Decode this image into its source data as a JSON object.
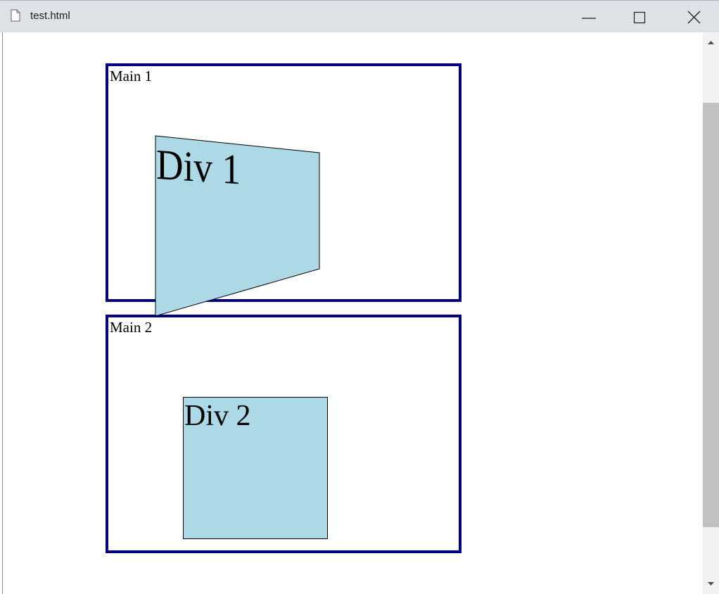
{
  "window": {
    "title": "test.html",
    "icons": {
      "file": "file-icon",
      "minimize": "minimize-icon",
      "maximize": "maximize-icon",
      "close": "close-icon"
    }
  },
  "page": {
    "main1": {
      "label": "Main 1",
      "border_color": "#000080"
    },
    "main2": {
      "label": "Main 2",
      "border_color": "#000080"
    },
    "div1": {
      "label": "Div 1",
      "fill": "#add8e6"
    },
    "div2": {
      "label": "Div 2",
      "fill": "#add8e6"
    }
  },
  "scrollbar": {
    "up_icon": "scroll-up-arrow-icon",
    "down_icon": "scroll-down-arrow-icon"
  }
}
